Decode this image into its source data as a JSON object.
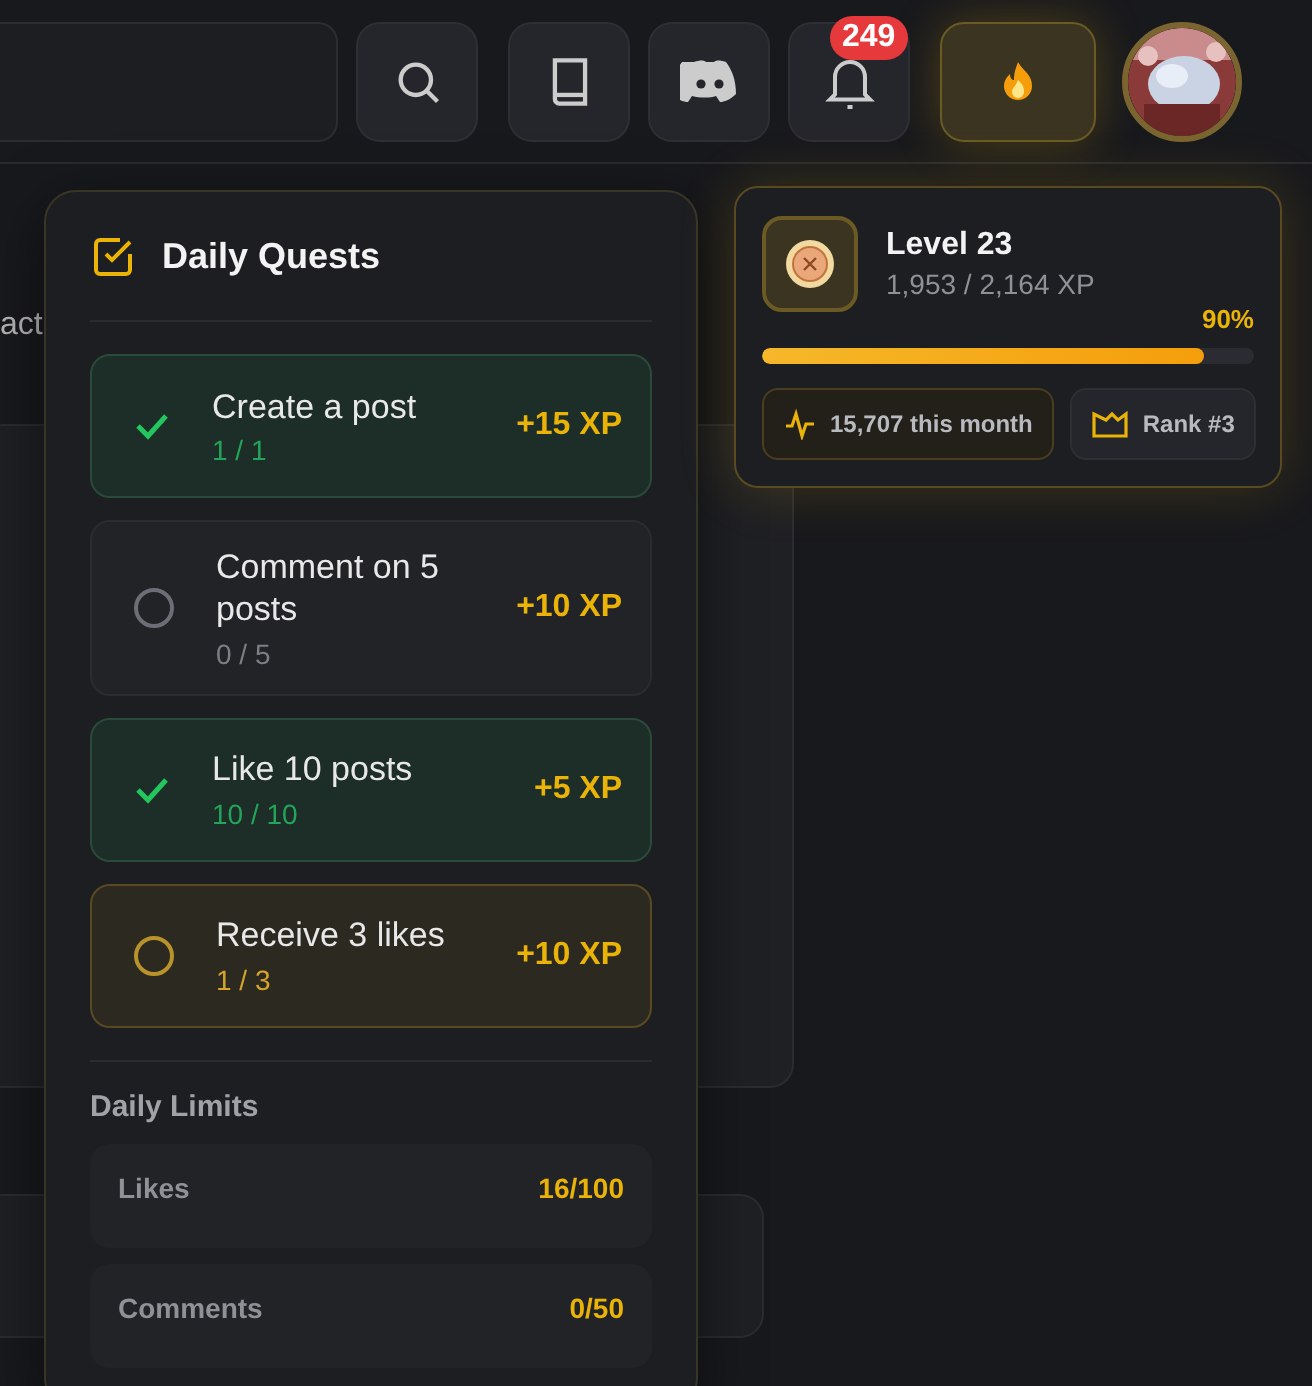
{
  "header": {
    "notifications_badge": "249"
  },
  "background": {
    "text": "act"
  },
  "quests": {
    "title": "Daily Quests",
    "items": [
      {
        "title": "Create a post",
        "progress": "1 / 1",
        "reward": "+15 XP",
        "completed": true,
        "highlighted": false
      },
      {
        "title": "Comment on 5 posts",
        "progress": "0 / 5",
        "reward": "+10 XP",
        "completed": false,
        "highlighted": false
      },
      {
        "title": "Like 10 posts",
        "progress": "10 / 10",
        "reward": "+5 XP",
        "completed": true,
        "highlighted": false
      },
      {
        "title": "Receive 3 likes",
        "progress": "1 / 3",
        "reward": "+10 XP",
        "completed": false,
        "highlighted": true
      }
    ],
    "limits_title": "Daily Limits",
    "limits": [
      {
        "label": "Likes",
        "value": "16/100"
      },
      {
        "label": "Comments",
        "value": "0/50"
      }
    ]
  },
  "level": {
    "title": "Level 23",
    "xp": "1,953 / 2,164 XP",
    "percent": "90%",
    "level": 0.9,
    "month": "15,707 this month",
    "rank": "Rank #3"
  }
}
